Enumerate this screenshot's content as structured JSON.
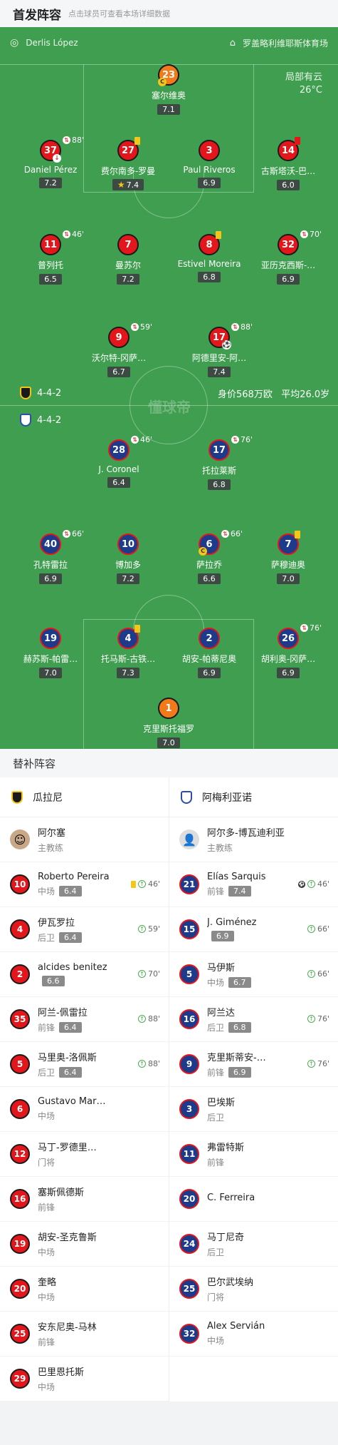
{
  "header": {
    "title": "首发阵容",
    "subtitle": "点击球员可查看本场详细数据"
  },
  "pitch": {
    "referee": "Derlis López",
    "stadium": "罗盖略利维耶斯体育场",
    "weather": "局部有云",
    "temp": "26°C",
    "watermark": "懂球帝"
  },
  "home": {
    "formation": "4-4-2",
    "value": "身价568万欧",
    "age": "平均26.0岁",
    "gk": {
      "num": "23",
      "name": "塞尔维奥",
      "rating": "7.1"
    },
    "d": [
      {
        "num": "37",
        "name": "Daniel Pérez",
        "rating": "7.2",
        "time": "88'"
      },
      {
        "num": "27",
        "name": "费尔南多-罗曼",
        "rating": "7.4"
      },
      {
        "num": "3",
        "name": "Paul Riveros",
        "rating": "6.9"
      },
      {
        "num": "14",
        "name": "古斯塔沃-巴…",
        "rating": "6.0"
      }
    ],
    "m": [
      {
        "num": "11",
        "name": "普列托",
        "rating": "6.5",
        "time": "46'"
      },
      {
        "num": "7",
        "name": "曼苏尔",
        "rating": "7.2"
      },
      {
        "num": "8",
        "name": "Estivel Moreira",
        "rating": "6.8"
      },
      {
        "num": "32",
        "name": "亚历克西斯-…",
        "rating": "6.9",
        "time": "70'"
      }
    ],
    "f": [
      {
        "num": "9",
        "name": "沃尔特-冈萨…",
        "rating": "6.7",
        "time": "59'"
      },
      {
        "num": "17",
        "name": "阿德里安-阿…",
        "rating": "7.4",
        "time": "88'"
      }
    ]
  },
  "away": {
    "formation": "4-4-2",
    "f": [
      {
        "num": "28",
        "name": "J. Coronel",
        "rating": "6.4",
        "time": "46'"
      },
      {
        "num": "17",
        "name": "托拉莱斯",
        "rating": "6.8",
        "time": "76'"
      }
    ],
    "m": [
      {
        "num": "40",
        "name": "孔特雷拉",
        "rating": "6.9",
        "time": "66'"
      },
      {
        "num": "10",
        "name": "博加多",
        "rating": "7.2"
      },
      {
        "num": "6",
        "name": "萨拉乔",
        "rating": "6.6",
        "time": "66'"
      },
      {
        "num": "7",
        "name": "萨穆迪奥",
        "rating": "7.0"
      }
    ],
    "d": [
      {
        "num": "19",
        "name": "赫苏斯-帕雷…",
        "rating": "7.0"
      },
      {
        "num": "4",
        "name": "托马斯-古铁…",
        "rating": "7.3"
      },
      {
        "num": "2",
        "name": "胡安-帕蒂尼奥",
        "rating": "6.9"
      },
      {
        "num": "26",
        "name": "胡利奥-冈萨…",
        "rating": "6.9",
        "time": "76'"
      }
    ],
    "gk": {
      "num": "1",
      "name": "克里斯托福罗",
      "rating": "7.0"
    }
  },
  "subs": {
    "title": "替补阵容",
    "home_team": "瓜拉尼",
    "away_team": "阿梅利亚诺",
    "home_coach": {
      "name": "阿尔塞",
      "role": "主教练"
    },
    "away_coach": {
      "name": "阿尔多-博瓦迪利亚",
      "role": "主教练"
    },
    "home": [
      {
        "num": "10",
        "name": "Roberto Pereira",
        "pos": "中场",
        "rating": "6.4",
        "time": "46'"
      },
      {
        "num": "4",
        "name": "伊瓦罗拉",
        "pos": "后卫",
        "rating": "6.4",
        "time": "59'"
      },
      {
        "num": "2",
        "name": "alcides benitez",
        "pos": "",
        "rating": "6.6",
        "time": "70'"
      },
      {
        "num": "35",
        "name": "阿兰-佩雷拉",
        "pos": "前锋",
        "rating": "6.4",
        "time": "88'"
      },
      {
        "num": "5",
        "name": "马里奥-洛佩斯",
        "pos": "后卫",
        "rating": "6.4",
        "time": "88'"
      },
      {
        "num": "6",
        "name": "Gustavo Mar…",
        "pos": "中场"
      },
      {
        "num": "12",
        "name": "马丁-罗德里…",
        "pos": "门将"
      },
      {
        "num": "16",
        "name": "塞斯佩德斯",
        "pos": "前锋"
      },
      {
        "num": "19",
        "name": "胡安-圣克鲁斯",
        "pos": "中场"
      },
      {
        "num": "20",
        "name": "奎略",
        "pos": "中场"
      },
      {
        "num": "25",
        "name": "安东尼奥-马林",
        "pos": "前锋"
      },
      {
        "num": "29",
        "name": "巴里恩托斯",
        "pos": "中场"
      }
    ],
    "away": [
      {
        "num": "21",
        "name": "Elías Sarquis",
        "pos": "前锋",
        "rating": "7.4",
        "time": "46'"
      },
      {
        "num": "15",
        "name": "J. Giménez",
        "pos": "",
        "rating": "6.9",
        "time": "66'"
      },
      {
        "num": "5",
        "name": "马伊斯",
        "pos": "中场",
        "rating": "6.7",
        "time": "66'"
      },
      {
        "num": "16",
        "name": "阿兰达",
        "pos": "后卫",
        "rating": "6.8",
        "time": "76'"
      },
      {
        "num": "9",
        "name": "克里斯蒂安-…",
        "pos": "前锋",
        "rating": "6.9",
        "time": "76'"
      },
      {
        "num": "3",
        "name": "巴埃斯",
        "pos": "后卫"
      },
      {
        "num": "11",
        "name": "弗雷特斯",
        "pos": "前锋"
      },
      {
        "num": "20",
        "name": "C. Ferreira",
        "pos": ""
      },
      {
        "num": "24",
        "name": "马丁尼奇",
        "pos": "后卫"
      },
      {
        "num": "25",
        "name": "巴尔武埃纳",
        "pos": "门将"
      },
      {
        "num": "32",
        "name": "Alex Servián",
        "pos": "中场"
      }
    ]
  }
}
